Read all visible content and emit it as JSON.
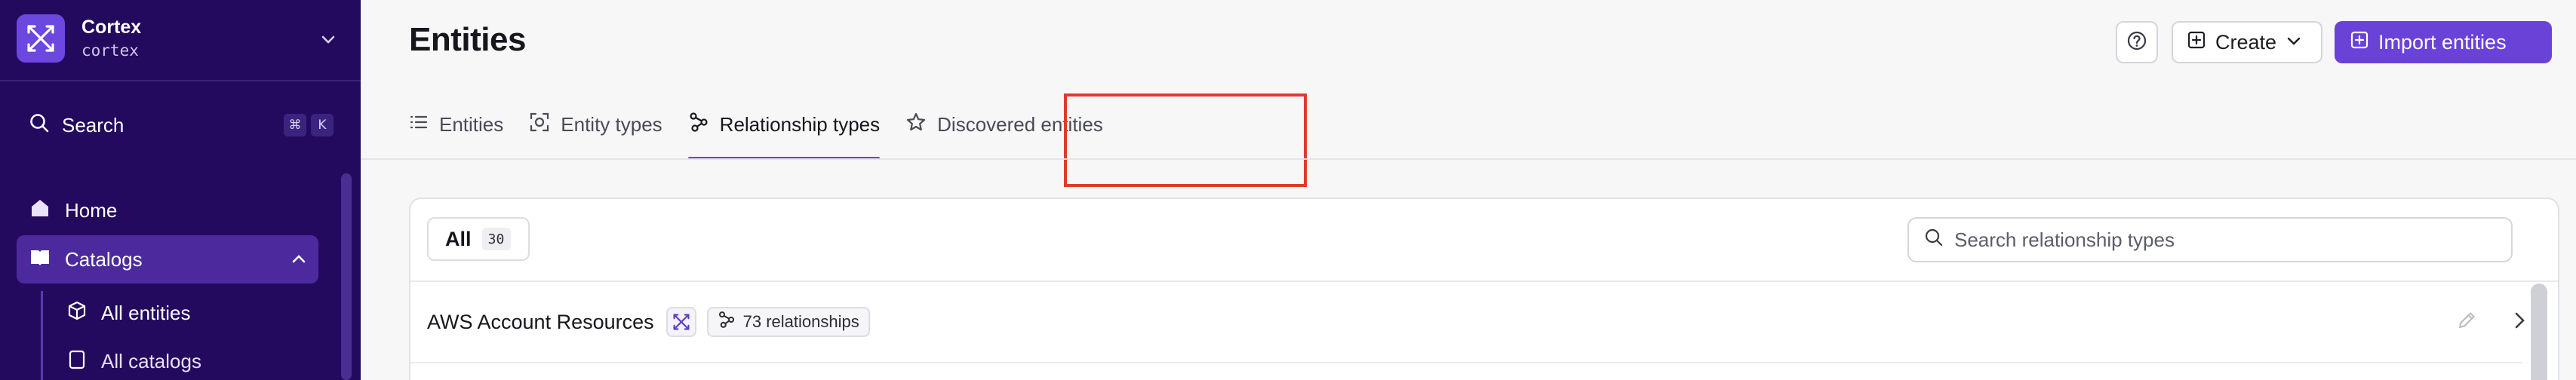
{
  "workspace": {
    "name": "Cortex",
    "slug": "cortex"
  },
  "sidebar": {
    "search_label": "Search",
    "shortcut_keys": [
      "⌘",
      "K"
    ],
    "items": [
      {
        "label": "Home",
        "icon": "home-icon"
      },
      {
        "label": "Catalogs",
        "icon": "book-icon",
        "expanded": true
      }
    ],
    "catalog_children": [
      {
        "label": "All entities",
        "icon": "cube-icon",
        "active": true
      },
      {
        "label": "All catalogs",
        "icon": "catalog-icon"
      }
    ]
  },
  "header": {
    "title": "Entities",
    "create_label": "Create",
    "import_label": "Import entities"
  },
  "tabs": [
    {
      "label": "Entities",
      "icon": "list-icon"
    },
    {
      "label": "Entity types",
      "icon": "entity-type-icon"
    },
    {
      "label": "Relationship types",
      "icon": "relationship-icon",
      "active": true
    },
    {
      "label": "Discovered entities",
      "icon": "star-icon"
    }
  ],
  "filter": {
    "all_label": "All",
    "count": "30"
  },
  "search": {
    "placeholder": "Search relationship types"
  },
  "rows": [
    {
      "name": "AWS Account Resources",
      "relationships": "73 relationships"
    }
  ],
  "colors": {
    "sidebar_bg": "#240a5e",
    "accent": "#6a42d8",
    "highlight_box": "#e03a2f"
  }
}
